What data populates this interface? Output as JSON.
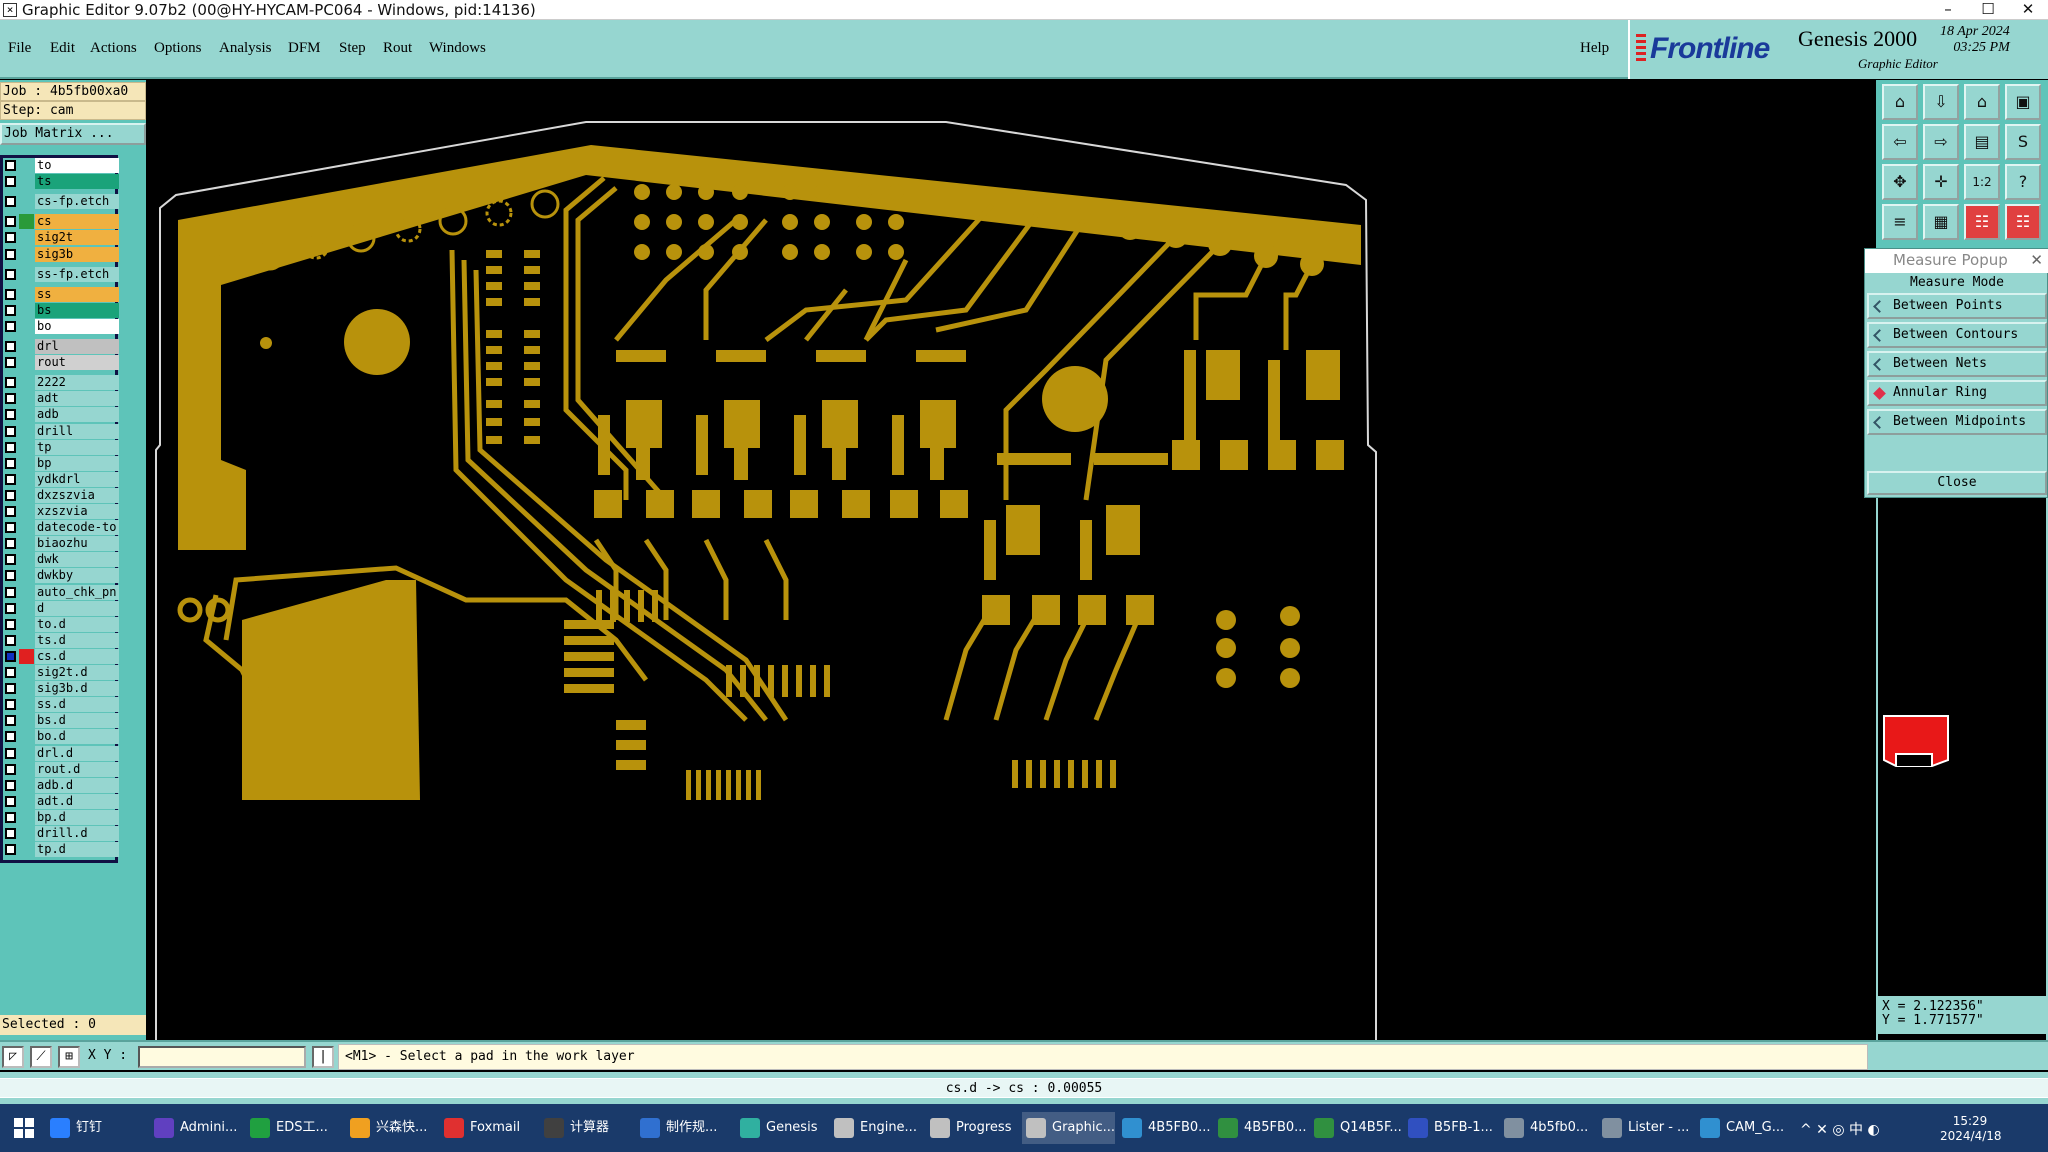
{
  "window": {
    "title": "Graphic Editor 9.07b2 (00@HY-HYCAM-PC064 - Windows, pid:14136)",
    "min": "–",
    "max": "☐",
    "close": "✕"
  },
  "menu": [
    "File",
    "Edit",
    "Actions",
    "Options",
    "Analysis",
    "DFM",
    "Step",
    "Rout",
    "Windows"
  ],
  "help": "Help",
  "brand": {
    "logo": "Frontline",
    "product": "Genesis 2000",
    "subtitle": "Graphic Editor",
    "date": "18 Apr 2024",
    "time": "03:25 PM"
  },
  "job": {
    "job_line": "Job : 4b5fb00xa0",
    "step_line": "Step: cam",
    "matrix_btn": "Job Matrix ..."
  },
  "layers": [
    {
      "name": "to",
      "bg": "#ffffff",
      "mark": ""
    },
    {
      "name": "ts",
      "bg": "#1aa37a",
      "mark": ""
    },
    {
      "name": "cs-fp.etch",
      "bg": "#96d6d0",
      "mark": "",
      "gap": true
    },
    {
      "name": "cs",
      "bg": "#f0b040",
      "mark": "#2a9a3a",
      "gap": true
    },
    {
      "name": "sig2t",
      "bg": "#f0b040",
      "mark": ""
    },
    {
      "name": "sig3b",
      "bg": "#f0b040",
      "mark": ""
    },
    {
      "name": "ss-fp.etch",
      "bg": "#96d6d0",
      "mark": "",
      "gap": true
    },
    {
      "name": "ss",
      "bg": "#f0b040",
      "mark": "",
      "gap": true
    },
    {
      "name": "bs",
      "bg": "#1aa37a",
      "mark": ""
    },
    {
      "name": "bo",
      "bg": "#ffffff",
      "mark": ""
    },
    {
      "name": "drl",
      "bg": "#c0c0c0",
      "mark": "",
      "gap": true
    },
    {
      "name": "rout",
      "bg": "#d0d0d0",
      "mark": ""
    },
    {
      "name": "2222",
      "bg": "#96d6d0",
      "mark": "",
      "gap": true
    },
    {
      "name": "adt",
      "bg": "#96d6d0",
      "mark": ""
    },
    {
      "name": "adb",
      "bg": "#96d6d0",
      "mark": ""
    },
    {
      "name": "drill",
      "bg": "#96d6d0",
      "mark": ""
    },
    {
      "name": "tp",
      "bg": "#96d6d0",
      "mark": ""
    },
    {
      "name": "bp",
      "bg": "#96d6d0",
      "mark": ""
    },
    {
      "name": "ydkdrl",
      "bg": "#96d6d0",
      "mark": ""
    },
    {
      "name": "dxzszvia",
      "bg": "#96d6d0",
      "mark": ""
    },
    {
      "name": "xzszvia",
      "bg": "#96d6d0",
      "mark": ""
    },
    {
      "name": "datecode-to",
      "bg": "#96d6d0",
      "mark": ""
    },
    {
      "name": "biaozhu",
      "bg": "#96d6d0",
      "mark": ""
    },
    {
      "name": "dwk",
      "bg": "#96d6d0",
      "mark": ""
    },
    {
      "name": "dwkby",
      "bg": "#96d6d0",
      "mark": ""
    },
    {
      "name": "auto_chk_pn",
      "bg": "#96d6d0",
      "mark": ""
    },
    {
      "name": "d",
      "bg": "#96d6d0",
      "mark": ""
    },
    {
      "name": "to.d",
      "bg": "#96d6d0",
      "mark": ""
    },
    {
      "name": "ts.d",
      "bg": "#96d6d0",
      "mark": ""
    },
    {
      "name": "cs.d",
      "bg": "#96d6d0",
      "mark": "#e02020",
      "blue": true
    },
    {
      "name": "sig2t.d",
      "bg": "#96d6d0",
      "mark": ""
    },
    {
      "name": "sig3b.d",
      "bg": "#96d6d0",
      "mark": ""
    },
    {
      "name": "ss.d",
      "bg": "#96d6d0",
      "mark": ""
    },
    {
      "name": "bs.d",
      "bg": "#96d6d0",
      "mark": ""
    },
    {
      "name": "bo.d",
      "bg": "#96d6d0",
      "mark": ""
    },
    {
      "name": "drl.d",
      "bg": "#96d6d0",
      "mark": ""
    },
    {
      "name": "rout.d",
      "bg": "#96d6d0",
      "mark": ""
    },
    {
      "name": "adb.d",
      "bg": "#96d6d0",
      "mark": ""
    },
    {
      "name": "adt.d",
      "bg": "#96d6d0",
      "mark": ""
    },
    {
      "name": "bp.d",
      "bg": "#96d6d0",
      "mark": ""
    },
    {
      "name": "drill.d",
      "bg": "#96d6d0",
      "mark": ""
    },
    {
      "name": "tp.d",
      "bg": "#96d6d0",
      "mark": ""
    }
  ],
  "selected": "Selected : 0",
  "tools": [
    {
      "name": "zoom-home-icon",
      "glyph": "⌂"
    },
    {
      "name": "zoom-in-icon",
      "glyph": "⇩"
    },
    {
      "name": "home-icon",
      "glyph": "⌂"
    },
    {
      "name": "window-icon",
      "glyph": "▣"
    },
    {
      "name": "pan-left-icon",
      "glyph": "⇦"
    },
    {
      "name": "pan-right-icon",
      "glyph": "⇨"
    },
    {
      "name": "zoom-window-icon",
      "glyph": "▤"
    },
    {
      "name": "redraw-icon",
      "glyph": "S"
    },
    {
      "name": "fit-icon",
      "glyph": "✥"
    },
    {
      "name": "center-icon",
      "glyph": "✛"
    },
    {
      "name": "scale-icon",
      "glyph": "1:2"
    },
    {
      "name": "query-icon",
      "glyph": "?"
    },
    {
      "name": "snap-icon",
      "glyph": "≡"
    },
    {
      "name": "grid-icon",
      "glyph": "▦"
    },
    {
      "name": "layers-red-icon",
      "glyph": "☷"
    },
    {
      "name": "layers-red2-icon",
      "glyph": "☷"
    }
  ],
  "measure": {
    "title": "Measure Popup",
    "mode_label": "Measure Mode",
    "options": [
      {
        "label": "Between Points",
        "on": false
      },
      {
        "label": "Between Contours",
        "on": false
      },
      {
        "label": "Between Nets",
        "on": false
      },
      {
        "label": "Annular Ring",
        "on": true
      },
      {
        "label": "Between Midpoints",
        "on": false
      }
    ],
    "close": "Close"
  },
  "coords": {
    "x": "X = 2.122356\"",
    "y": "Y = 1.771577\""
  },
  "cmd": {
    "xy_label": "X Y :",
    "input_value": "",
    "message": "<M1> - Select a pad in the work layer"
  },
  "status": "cs.d -> cs : 0.00055",
  "taskbar": [
    {
      "label": "钉钉",
      "color": "#2a7fff"
    },
    {
      "label": "Admini...",
      "color": "#6040c0"
    },
    {
      "label": "EDS工...",
      "color": "#20a040"
    },
    {
      "label": "兴森快...",
      "color": "#f0a020"
    },
    {
      "label": "Foxmail",
      "color": "#e03030"
    },
    {
      "label": "计算器",
      "color": "#404040"
    },
    {
      "label": "制作规...",
      "color": "#3070d0"
    },
    {
      "label": "Genesis",
      "color": "#30b0a0"
    },
    {
      "label": "Engine...",
      "color": "#c0c0c0"
    },
    {
      "label": "Progress",
      "color": "#c0c0c0"
    },
    {
      "label": "Graphic...",
      "color": "#c0c0c0"
    },
    {
      "label": "4B5FB0...",
      "color": "#3090d0"
    },
    {
      "label": "4B5FB0...",
      "color": "#309040"
    },
    {
      "label": "Q14B5F...",
      "color": "#309040"
    },
    {
      "label": "B5FB-1...",
      "color": "#3050c0"
    },
    {
      "label": "4b5fb0...",
      "color": "#8090a0"
    },
    {
      "label": "Lister - ...",
      "color": "#8090a0"
    },
    {
      "label": "CAM_G...",
      "color": "#3090d0"
    }
  ],
  "tray": {
    "time": "15:29",
    "date": "2024/4/18",
    "ime": "中"
  },
  "colors": {
    "copper": "#b8920c",
    "outline": "#e0e0e0",
    "canvas": "#000000"
  }
}
